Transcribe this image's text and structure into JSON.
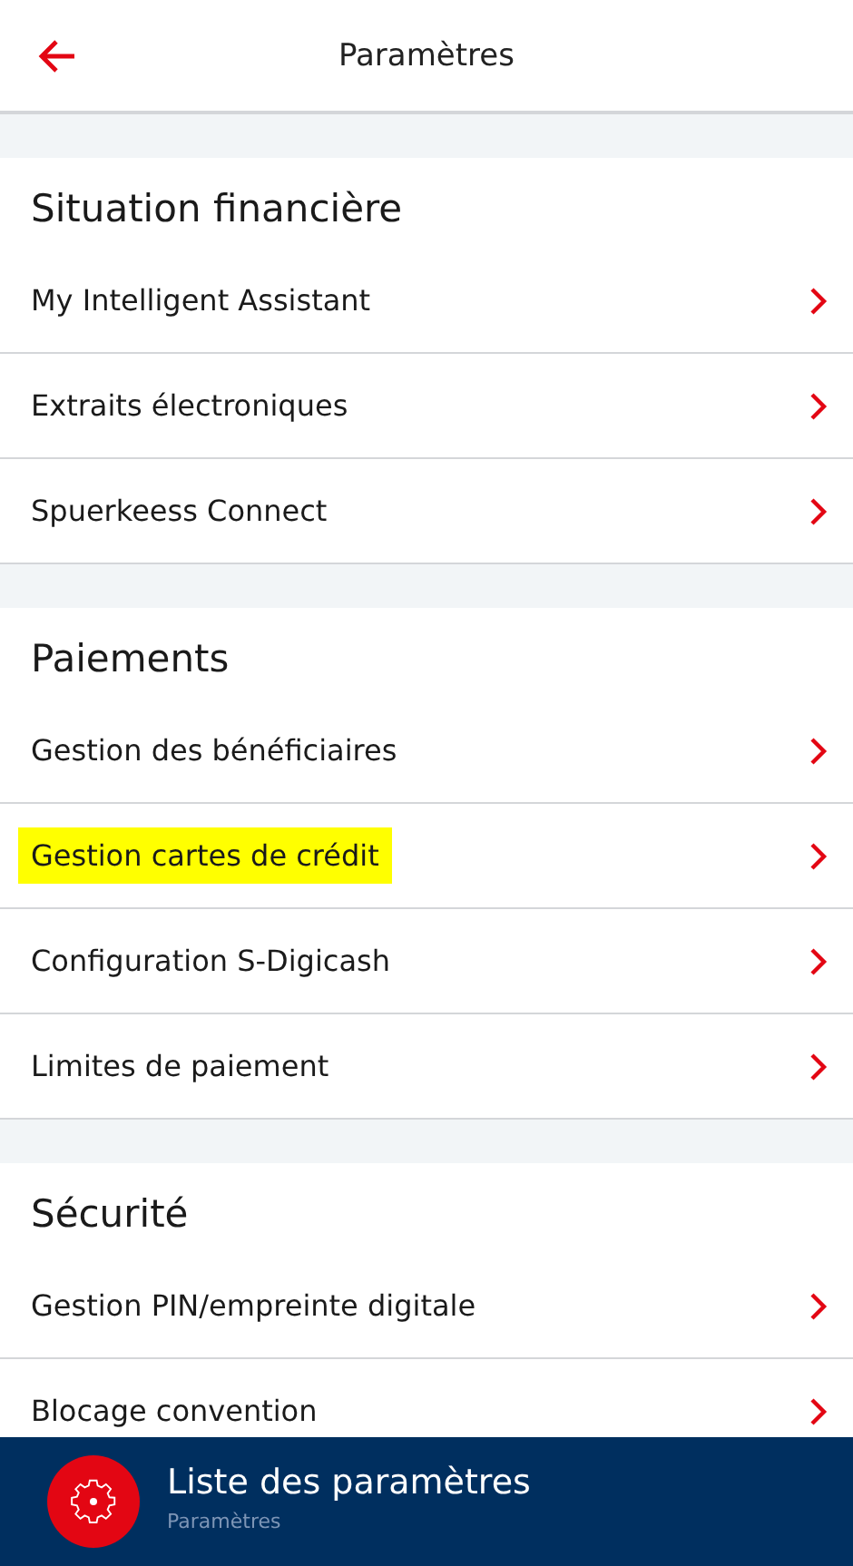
{
  "header": {
    "title": "Paramètres"
  },
  "sections": [
    {
      "title": "Situation financière",
      "items": [
        {
          "label": "My Intelligent Assistant",
          "highlighted": false
        },
        {
          "label": "Extraits électroniques",
          "highlighted": false
        },
        {
          "label": "Spuerkeess Connect",
          "highlighted": false
        }
      ]
    },
    {
      "title": "Paiements",
      "items": [
        {
          "label": "Gestion des bénéficiaires",
          "highlighted": false
        },
        {
          "label": "Gestion cartes de crédit",
          "highlighted": true
        },
        {
          "label": "Configuration S-Digicash",
          "highlighted": false
        },
        {
          "label": "Limites de paiement",
          "highlighted": false
        }
      ]
    },
    {
      "title": "Sécurité",
      "items": [
        {
          "label": "Gestion PIN/empreinte digitale",
          "highlighted": false
        },
        {
          "label": "Blocage convention",
          "highlighted": false
        }
      ]
    }
  ],
  "bottom_bar": {
    "title": "Liste des paramètres",
    "subtitle": "Paramètres"
  }
}
